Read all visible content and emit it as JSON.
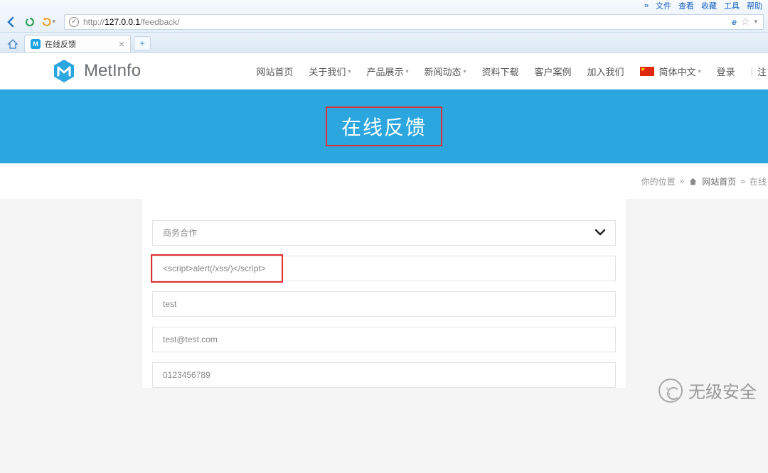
{
  "browser": {
    "top_menus": [
      "»",
      "文件",
      "查看",
      "收藏",
      "工具",
      "帮助"
    ],
    "url_protocol": "http://",
    "url_host": "127.0.0.1",
    "url_path": "/feedback/",
    "tab": {
      "title": "在线反馈",
      "favicon_letter": "M"
    }
  },
  "site": {
    "logo_text": "MetInfo",
    "nav": [
      {
        "label": "网站首页",
        "dropdown": false
      },
      {
        "label": "关于我们",
        "dropdown": true
      },
      {
        "label": "产品展示",
        "dropdown": true
      },
      {
        "label": "新闻动态",
        "dropdown": true
      },
      {
        "label": "资料下载",
        "dropdown": false
      },
      {
        "label": "客户案例",
        "dropdown": false
      },
      {
        "label": "加入我们",
        "dropdown": false
      }
    ],
    "lang_label": "简体中文",
    "login_label": "登录",
    "register_label": "注"
  },
  "hero": {
    "title": "在线反馈"
  },
  "breadcrumb": {
    "prefix": "你的位置",
    "sep": "»",
    "home": "网站首页",
    "current": "在线"
  },
  "form": {
    "select_value": "商务合作",
    "name_value": "<script>alert(/xss/)</script>",
    "input2_value": "test",
    "input3_value": "test@test.com",
    "input4_value": "0123456789"
  },
  "watermark": {
    "text": "无级安全"
  }
}
